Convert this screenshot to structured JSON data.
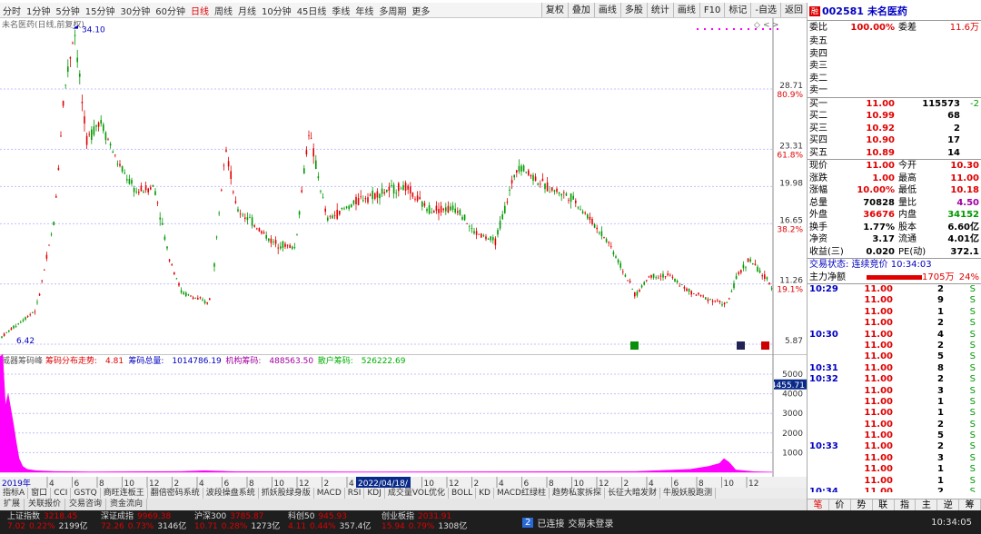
{
  "periods": [
    "分时",
    "1分钟",
    "5分钟",
    "15分钟",
    "30分钟",
    "60分钟",
    "日线",
    "周线",
    "月线",
    "10分钟",
    "45日线",
    "季线",
    "年线",
    "多周期",
    "更多"
  ],
  "active_period": "日线",
  "tools": [
    "复权",
    "叠加",
    "画线",
    "多股",
    "统计",
    "画线",
    "F10",
    "标记",
    "-自选",
    "返回"
  ],
  "main_title": "未名医药(日线,前复权)",
  "chart_icons": [
    "◇",
    "<",
    ">"
  ],
  "price_axis": [
    {
      "v": "28.71",
      "p": "80.9%"
    },
    {
      "v": "23.31",
      "p": "61.8%"
    },
    {
      "v": "19.98",
      "p": ""
    },
    {
      "v": "16.65",
      "p": "38.2%"
    },
    {
      "v": "11.26",
      "p": "19.1%"
    },
    {
      "v": "5.87",
      "p": ""
    }
  ],
  "high_label": "34.10",
  "low_label": "6.42",
  "sub_title": {
    "name": "威器筹码峰",
    "a_label": "筹码分布走势:",
    "a": "4.81",
    "b_label": "筹码总量:",
    "b": "1014786.19",
    "c_label": "机构筹码:",
    "c": "488563.50",
    "d_label": "散户筹码:",
    "d": "526222.69"
  },
  "sub_axis": [
    "5000",
    "4000",
    "3000",
    "2000",
    "1000"
  ],
  "sub_axis_hl": "4455.71",
  "xaxis_year": "2019年",
  "xaxis_date": "2022/04/18/",
  "xaxis_ticks": [
    "4",
    "6",
    "8",
    "10",
    "12",
    "2",
    "4",
    "6",
    "8",
    "10",
    "12",
    "2",
    "4",
    "6",
    "8",
    "10",
    "12",
    "2",
    "4",
    "6",
    "8",
    "10",
    "12",
    "2",
    "4",
    "6",
    "8",
    "10",
    "12"
  ],
  "indicator_tabs": [
    "指标A",
    "窗口",
    "CCI",
    "GSTQ",
    "商旺连板王",
    "翻倍密码系统",
    "波段操盘系统",
    "抓妖股绿身版",
    "MACD",
    "RSI",
    "KDJ",
    "成交量VOL优化",
    "BOLL",
    "KD",
    "MACD红绿柱",
    "趋势私家拆探",
    "长征大暗发财",
    "牛股妖股跑测"
  ],
  "bottom_tabs": [
    "扩展",
    "关联报价",
    "交易咨询",
    "资金流向"
  ],
  "stock": {
    "code": "002581",
    "name": "未名医药",
    "badge": "融"
  },
  "weibi": {
    "label": "委比",
    "value": "100.00%",
    "diff_label": "委差",
    "diff": "11.6万"
  },
  "asks": [
    {
      "l": "卖五"
    },
    {
      "l": "卖四"
    },
    {
      "l": "卖三"
    },
    {
      "l": "卖二"
    },
    {
      "l": "卖一"
    }
  ],
  "bids": [
    {
      "l": "买一",
      "p": "11.00",
      "v": "115573",
      "c": "-2"
    },
    {
      "l": "买二",
      "p": "10.99",
      "v": "68",
      "c": ""
    },
    {
      "l": "买三",
      "p": "10.92",
      "v": "2",
      "c": ""
    },
    {
      "l": "买四",
      "p": "10.90",
      "v": "17",
      "c": ""
    },
    {
      "l": "买五",
      "p": "10.89",
      "v": "14",
      "c": ""
    }
  ],
  "quote": [
    {
      "l1": "现价",
      "v1": "11.00",
      "c1": "r",
      "l2": "今开",
      "v2": "10.30",
      "c2": "r"
    },
    {
      "l1": "涨跌",
      "v1": "1.00",
      "c1": "r",
      "l2": "最高",
      "v2": "11.00",
      "c2": "r"
    },
    {
      "l1": "涨幅",
      "v1": "10.00%",
      "c1": "r",
      "l2": "最低",
      "v2": "10.18",
      "c2": "r"
    },
    {
      "l1": "总量",
      "v1": "70828",
      "c1": "b",
      "l2": "量比",
      "v2": "4.50",
      "c2": "p"
    },
    {
      "l1": "外盘",
      "v1": "36676",
      "c1": "r",
      "l2": "内盘",
      "v2": "34152",
      "c2": "g"
    },
    {
      "l1": "换手",
      "v1": "1.77%",
      "c1": "b",
      "l2": "股本",
      "v2": "6.60亿",
      "c2": "b"
    },
    {
      "l1": "净资",
      "v1": "3.17",
      "c1": "b",
      "l2": "流通",
      "v2": "4.01亿",
      "c2": "b"
    },
    {
      "l1": "收益(三)",
      "v1": "0.020",
      "c1": "b",
      "l2": "PE(动)",
      "v2": "372.1",
      "c2": "b"
    }
  ],
  "trade_status": "交易状态: 连续竞价 10:34:03",
  "netflow": {
    "label": "主力净额",
    "value": "1705万",
    "pct": "24%"
  },
  "ticks": [
    {
      "t": "10:29",
      "p": "11.00",
      "v": "2",
      "s": "S"
    },
    {
      "t": "",
      "p": "11.00",
      "v": "9",
      "s": "S"
    },
    {
      "t": "",
      "p": "11.00",
      "v": "1",
      "s": "S"
    },
    {
      "t": "",
      "p": "11.00",
      "v": "2",
      "s": "S"
    },
    {
      "t": "10:30",
      "p": "11.00",
      "v": "4",
      "s": "S"
    },
    {
      "t": "",
      "p": "11.00",
      "v": "2",
      "s": "S"
    },
    {
      "t": "",
      "p": "11.00",
      "v": "5",
      "s": "S"
    },
    {
      "t": "10:31",
      "p": "11.00",
      "v": "8",
      "s": "S"
    },
    {
      "t": "10:32",
      "p": "11.00",
      "v": "2",
      "s": "S"
    },
    {
      "t": "",
      "p": "11.00",
      "v": "3",
      "s": "S"
    },
    {
      "t": "",
      "p": "11.00",
      "v": "1",
      "s": "S"
    },
    {
      "t": "",
      "p": "11.00",
      "v": "1",
      "s": "S"
    },
    {
      "t": "",
      "p": "11.00",
      "v": "2",
      "s": "S"
    },
    {
      "t": "",
      "p": "11.00",
      "v": "5",
      "s": "S"
    },
    {
      "t": "10:33",
      "p": "11.00",
      "v": "2",
      "s": "S"
    },
    {
      "t": "",
      "p": "11.00",
      "v": "3",
      "s": "S"
    },
    {
      "t": "",
      "p": "11.00",
      "v": "1",
      "s": "S"
    },
    {
      "t": "",
      "p": "11.00",
      "v": "1",
      "s": "S"
    },
    {
      "t": "10:34",
      "p": "11.00",
      "v": "2",
      "s": "S"
    }
  ],
  "right_tabs": [
    "笔",
    "价",
    "势",
    "联",
    "指",
    "主",
    "逆",
    "筹"
  ],
  "status": {
    "indices": [
      {
        "name": "上证指数",
        "value": "3218.45",
        "chg": "7.02",
        "pct": "0.22%",
        "amt": "2199亿"
      },
      {
        "name": "深证成指",
        "value": "9969.38",
        "chg": "72.26",
        "pct": "0.73%",
        "amt": "3146亿"
      },
      {
        "name": "沪深300",
        "value": "3785.87",
        "chg": "10.71",
        "pct": "0.28%",
        "amt": "1273亿"
      },
      {
        "name": "科创50",
        "value": "945.93",
        "chg": "4.11",
        "pct": "0.44%",
        "amt": "357.4亿"
      },
      {
        "name": "创业板指",
        "value": "2031.91",
        "chg": "15.94",
        "pct": "0.79%",
        "amt": "1308亿"
      }
    ],
    "conn": "已连接",
    "trade": "交易未登录",
    "time": "10:34:05",
    "badge": "2"
  },
  "colors": {
    "up": "#e00000",
    "down": "#009900",
    "chip": "#ff00ff",
    "grid": "#c0c0ff"
  }
}
